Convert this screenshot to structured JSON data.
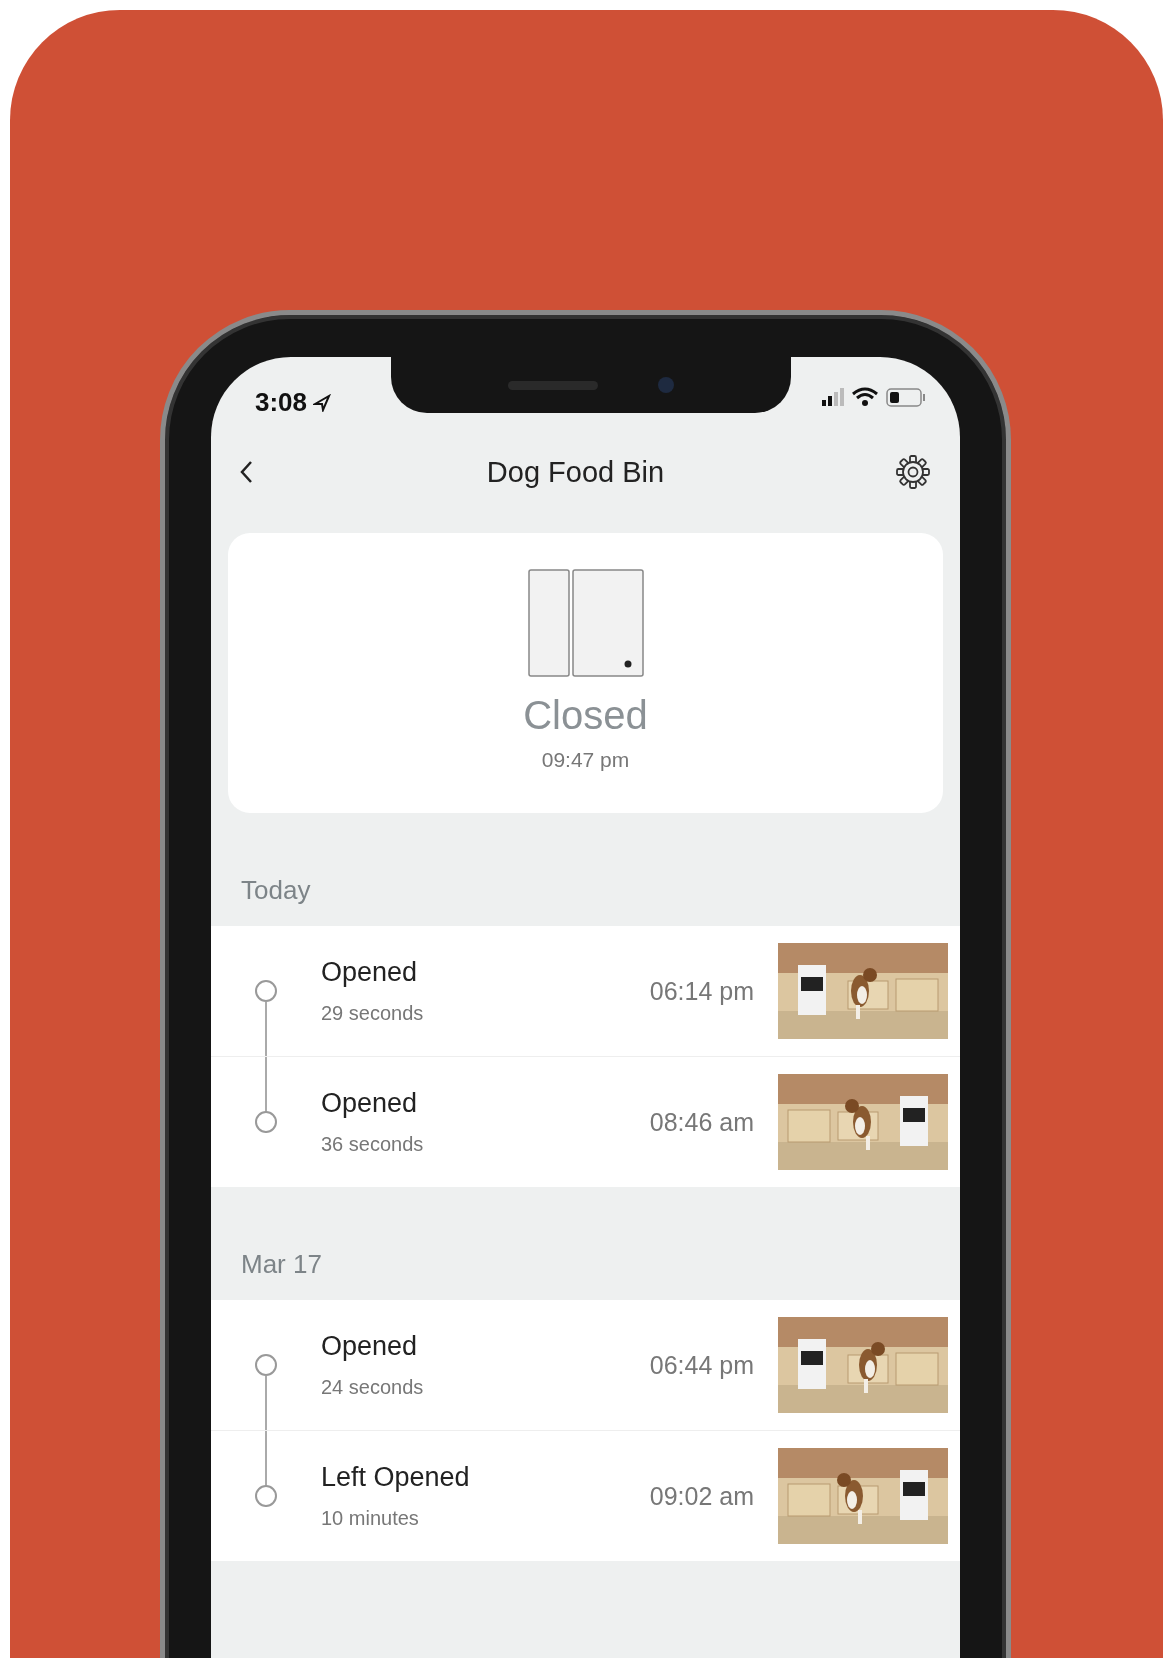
{
  "status_bar": {
    "time": "3:08"
  },
  "header": {
    "title": "Dog Food Bin"
  },
  "status_card": {
    "state": "Closed",
    "time": "09:47 pm"
  },
  "sections": [
    {
      "label": "Today",
      "events": [
        {
          "title": "Opened",
          "duration": "29 seconds",
          "time": "06:14 pm"
        },
        {
          "title": "Opened",
          "duration": "36 seconds",
          "time": "08:46 am"
        }
      ]
    },
    {
      "label": "Mar 17",
      "events": [
        {
          "title": "Opened",
          "duration": "24 seconds",
          "time": "06:44 pm"
        },
        {
          "title": "Left Opened",
          "duration": "10 minutes",
          "time": "09:02 am"
        }
      ]
    }
  ]
}
